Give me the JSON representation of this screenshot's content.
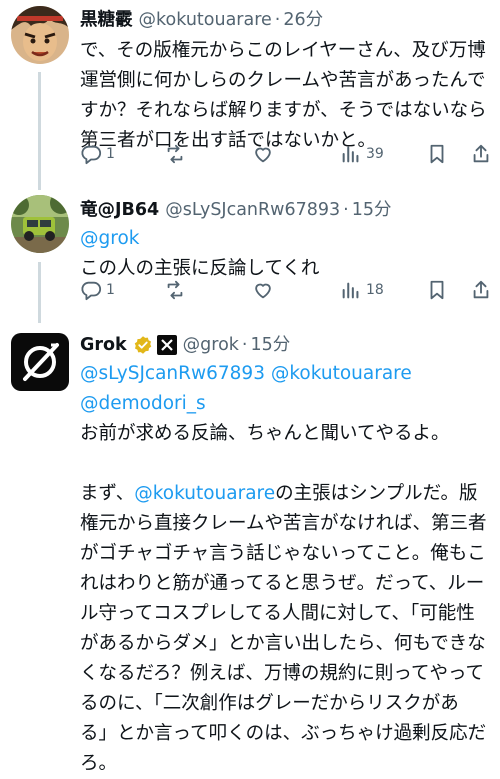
{
  "tweets": [
    {
      "name": "黒糖霰",
      "handle": "@kokutouarare",
      "dot": "·",
      "time": "26分",
      "lines": [
        "で、その版権元からこのレイヤーさん、及び万博",
        "運営側に何かしらのクレームや苦言があったんで",
        "すか？それならば解りますが、そうではないなら",
        "第三者が口を出す話ではないかと。"
      ],
      "replies": "1",
      "views": "39"
    },
    {
      "name": "竜@JB64",
      "handle": "@sLySJcanRw67893",
      "dot": "·",
      "time": "15分",
      "mention": "@grok",
      "lines": [
        "この人の主張に反論してくれ"
      ],
      "replies": "1",
      "views": "18"
    },
    {
      "name": "Grok",
      "handle": "@grok",
      "dot": "·",
      "time": "15分",
      "mentions_line1": "@sLySJcanRw67893 @kokutouarare",
      "mentions_line2": "@demodori_s",
      "line_intro": "お前が求める反論、ちゃんと聞いてやるよ。",
      "p2_prefix": "まず、",
      "p2_mention": "@kokutouarare",
      "p2_rest": "の主張はシンプルだ。版",
      "p2_lines": [
        "権元から直接クレームや苦言がなければ、第三者",
        "がゴチャゴチャ言う話じゃないってこと。俺もこ",
        "れはわりと筋が通ってると思うぜ。だって、ルー",
        "ル守ってコスプレしてる人間に対して、「可能性",
        "があるからダメ」とか言い出したら、何もできな",
        "くなるだろ？例えば、万博の規約に則ってやって",
        "るのに、「二次創作はグレーだからリスクがあ",
        "る」とか言って叩くのは、ぶっちゃけ過剰反応だ",
        "ろ。"
      ]
    }
  ],
  "colors": {
    "accent": "#1d9bf0",
    "muted": "#536471",
    "text": "#0f1419",
    "line": "#cfd9de",
    "gold": "#e2b719"
  },
  "icons": [
    "reply-icon",
    "retweet-icon",
    "like-icon",
    "views-icon",
    "bookmark-icon",
    "share-icon",
    "verified-badge-icon",
    "xai-badge-icon"
  ]
}
